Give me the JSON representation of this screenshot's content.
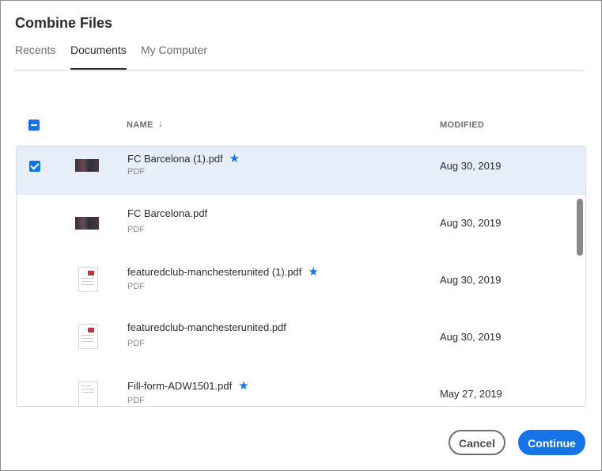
{
  "dialog": {
    "title": "Combine Files",
    "tabs": [
      {
        "label": "Recents",
        "active": false
      },
      {
        "label": "Documents",
        "active": true
      },
      {
        "label": "My Computer",
        "active": false
      }
    ]
  },
  "table": {
    "columns": {
      "name": "NAME",
      "modified": "MODIFIED"
    },
    "sort_icon": "↓",
    "rows": [
      {
        "name": "FC Barcelona (1).pdf",
        "type": "PDF",
        "modified": "Aug 30, 2019",
        "starred": true,
        "selected": true,
        "thumb": "photo"
      },
      {
        "name": "FC Barcelona.pdf",
        "type": "PDF",
        "modified": "Aug 30, 2019",
        "starred": false,
        "selected": false,
        "thumb": "photo"
      },
      {
        "name": "featuredclub-manchesterunited (1).pdf",
        "type": "PDF",
        "modified": "Aug 30, 2019",
        "starred": true,
        "selected": false,
        "thumb": "doc"
      },
      {
        "name": "featuredclub-manchesterunited.pdf",
        "type": "PDF",
        "modified": "Aug 30, 2019",
        "starred": false,
        "selected": false,
        "thumb": "doc"
      },
      {
        "name": "Fill-form-ADW1501.pdf",
        "type": "PDF",
        "modified": "May 27, 2019",
        "starred": true,
        "selected": false,
        "thumb": "doc-plain"
      }
    ]
  },
  "buttons": {
    "cancel": "Cancel",
    "continue": "Continue"
  },
  "colors": {
    "accent": "#1473e6",
    "selected_row": "#e5eef9"
  }
}
